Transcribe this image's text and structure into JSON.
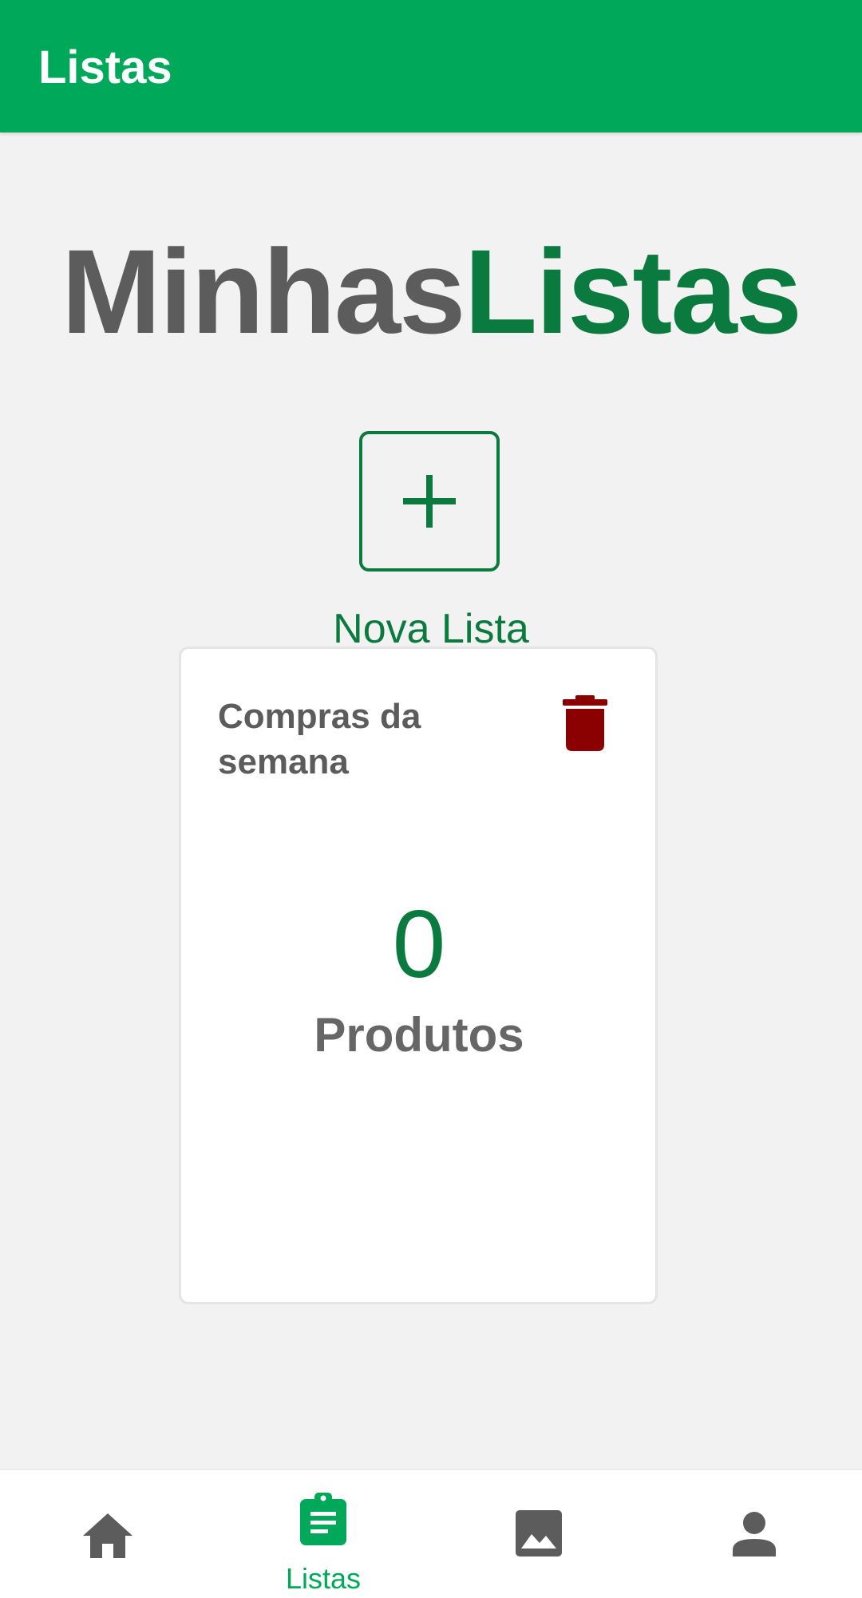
{
  "appbar": {
    "title": "Listas"
  },
  "hero": {
    "word1": "Minhas",
    "word2": "Listas"
  },
  "add_list": {
    "label": "Nova Lista"
  },
  "lists": [
    {
      "title": "Compras da semana",
      "count": "0",
      "count_label": "Produtos"
    }
  ],
  "bottom_nav": {
    "items": [
      {
        "icon": "home-icon",
        "label": ""
      },
      {
        "icon": "clipboard-list-icon",
        "label": "Listas",
        "active": true
      },
      {
        "icon": "image-icon",
        "label": ""
      },
      {
        "icon": "person-icon",
        "label": ""
      }
    ]
  },
  "colors": {
    "primary": "#00a85a",
    "dark_green": "#0b7a3e",
    "text_gray": "#5c5c5c",
    "delete_red": "#8b0000",
    "icon_gray": "#5c5c5c"
  }
}
